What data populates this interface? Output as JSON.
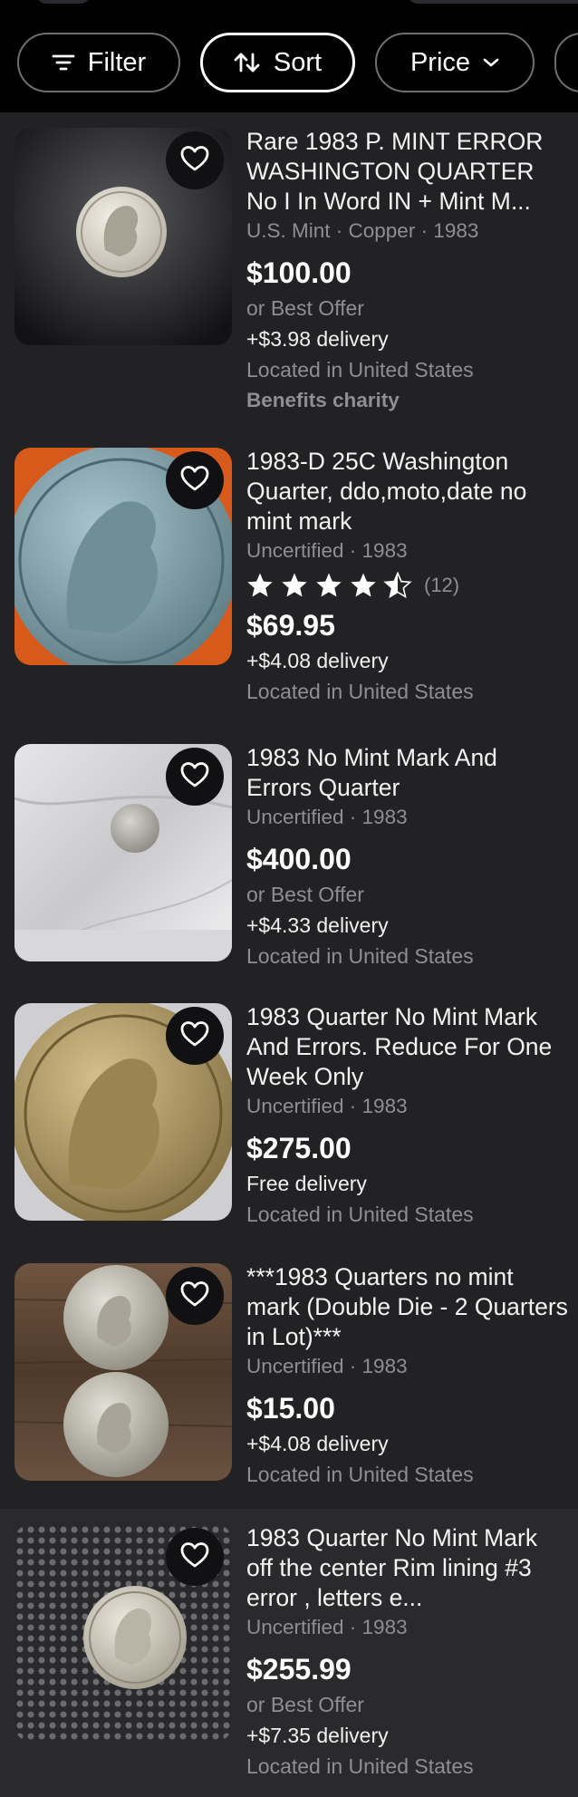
{
  "filters": {
    "filter_label": "Filter",
    "sort_label": "Sort",
    "price_label": "Price"
  },
  "listings": [
    {
      "title": "Rare 1983 P. MINT ERROR WASHINGTON QUARTER No I In Word IN + Mint M...",
      "subtitle": "U.S. Mint · Copper · 1983",
      "price": "$100.00",
      "best_offer": "or Best Offer",
      "delivery": "+$3.98 delivery",
      "location": "Located in United States",
      "charity": "Benefits charity"
    },
    {
      "title": "1983-D 25C Washington Quarter, ddo,moto,date no mint mark",
      "subtitle": "Uncertified · 1983",
      "rating_value": 4.5,
      "rating_count": "(12)",
      "price": "$69.95",
      "delivery": "+$4.08 delivery",
      "location": "Located in United States"
    },
    {
      "title": "1983 No Mint Mark And Errors Quarter",
      "subtitle": "Uncertified · 1983",
      "price": "$400.00",
      "best_offer": "or Best Offer",
      "delivery": "+$4.33 delivery",
      "location": "Located in United States"
    },
    {
      "title": "1983  Quarter No Mint Mark And Errors. Reduce For One Week Only",
      "subtitle": "Uncertified · 1983",
      "price": "$275.00",
      "delivery": "Free delivery",
      "location": "Located in United States"
    },
    {
      "title": "***1983 Quarters no mint mark (Double Die - 2 Quarters in Lot)***",
      "subtitle": "Uncertified · 1983",
      "price": "$15.00",
      "delivery": "+$4.08 delivery",
      "location": "Located in United States"
    },
    {
      "title": "1983 Quarter No Mint Mark off the center Rim lining  #3 error , letters e...",
      "subtitle": "Uncertified · 1983",
      "price": "$255.99",
      "best_offer": "or Best Offer",
      "delivery": "+$7.35 delivery",
      "location": "Located in United States"
    }
  ],
  "icons": {
    "heart": "heart-outline-icon",
    "filter": "filter-lines-icon",
    "sort": "sort-arrows-icon",
    "price": "chevron-down-icon",
    "star": "star-icon"
  },
  "colors": {
    "background": "#222225",
    "top_bar": "#000000",
    "muted_text": "#8e8e93"
  }
}
